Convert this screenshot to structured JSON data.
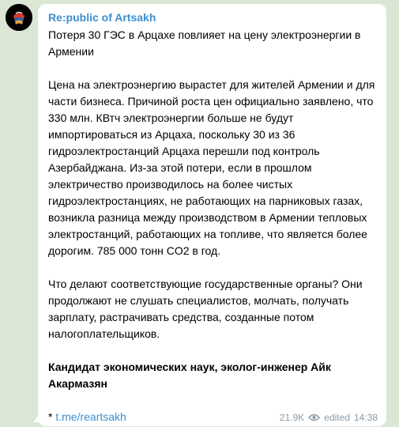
{
  "channel": {
    "name": "Re:public of Artsakh"
  },
  "post": {
    "headline": "Потеря 30 ГЭС в Арцахе повлияет на цену электроэнергии в Армении",
    "paragraph_1": "Цена на электроэнергию вырастет для жителей Армении и для части бизнеса. Причиной роста цен официально заявлено, что 330 млн. КВтч электроэнергии больше не будут импортироваться из Арцаха, поскольку 30 из 36 гидроэлектростанций Арцаха перешли под контроль Азербайджана. Из-за этой потери, если в прошлом электричество производилось на более чистых гидроэлектростанциях, не работающих на парниковых газах, возникла разница между производством в Армении тепловых электростанций, работающих на топливе, что является более дорогим. 785 000 тонн CO2 в год.",
    "paragraph_2": "Что делают соответствующие государственные органы? Они продолжают не слушать специалистов, молчать, получать зарплату, растрачивать средства, созданные потом налогоплательщиков.",
    "signature": "Кандидат экономических наук, эколог-инженер Айк Акармазян",
    "link_prefix": "* ",
    "link_text": "t.me/reartsakh"
  },
  "meta": {
    "views": "21.9K",
    "edited_label": "edited",
    "time": "14:38"
  },
  "icons": {
    "avatar": "channel-logo",
    "views": "eye-icon"
  },
  "colors": {
    "background": "#dbe6d4",
    "link": "#3a8fd0",
    "meta_text": "#8c9aa6"
  }
}
